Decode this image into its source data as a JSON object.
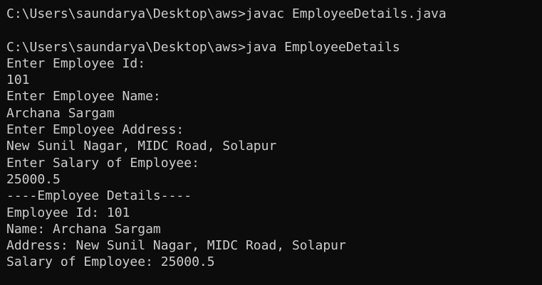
{
  "theme": {
    "background": "#0c0c0c",
    "foreground": "#cccccc"
  },
  "terminal": {
    "lines": [
      "C:\\Users\\saundarya\\Desktop\\aws>javac EmployeeDetails.java",
      "",
      "C:\\Users\\saundarya\\Desktop\\aws>java EmployeeDetails",
      "Enter Employee Id:",
      "101",
      "Enter Employee Name:",
      "Archana Sargam",
      "Enter Employee Address:",
      "New Sunil Nagar, MIDC Road, Solapur",
      "Enter Salary of Employee:",
      "25000.5",
      "----Employee Details----",
      "Employee Id: 101",
      "Name: Archana Sargam",
      "Address: New Sunil Nagar, MIDC Road, Solapur",
      "Salary of Employee: 25000.5"
    ]
  }
}
